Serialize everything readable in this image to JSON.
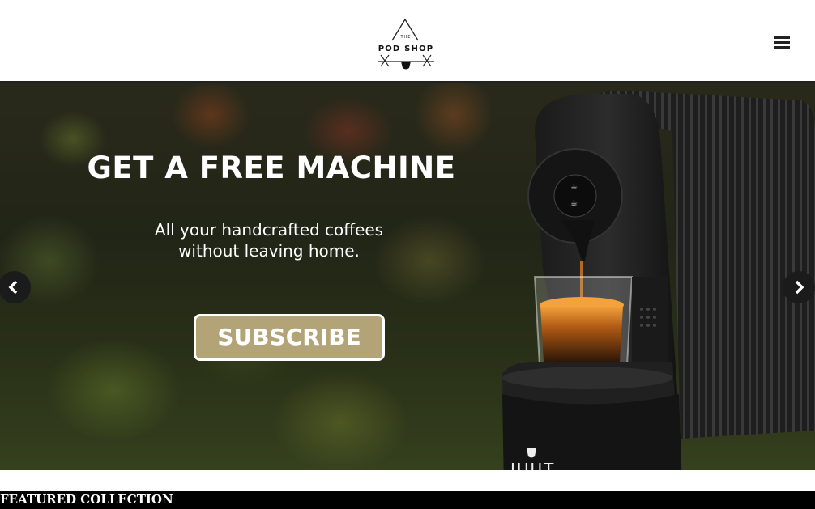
{
  "header": {
    "logo_small": "THE",
    "logo_name": "POD SHOP",
    "menu_icon": "hamburger-menu-icon"
  },
  "hero": {
    "title": "GET A FREE MACHINE",
    "subtitle_line1": "All your handcrafted coffees",
    "subtitle_line2": "without leaving home.",
    "cta_label": "SUBSCRIBE",
    "cta_color": "#b3a478",
    "machine_brand": "JUUT",
    "prev_icon": "chevron-left-icon",
    "next_icon": "chevron-right-icon"
  },
  "featured": {
    "heading": "FEATURED COLLECTION"
  }
}
